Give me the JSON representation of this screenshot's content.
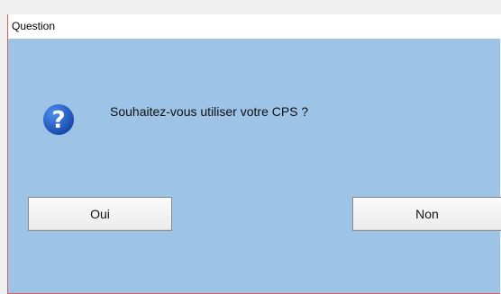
{
  "window": {
    "title": "Question"
  },
  "dialog": {
    "message": "Souhaitez-vous utiliser votre CPS ?",
    "icon": "question-icon",
    "accent_color": "#1e5bbf",
    "background_color": "#9dc3e6"
  },
  "buttons": {
    "yes_label": "Oui",
    "no_label": "Non"
  }
}
